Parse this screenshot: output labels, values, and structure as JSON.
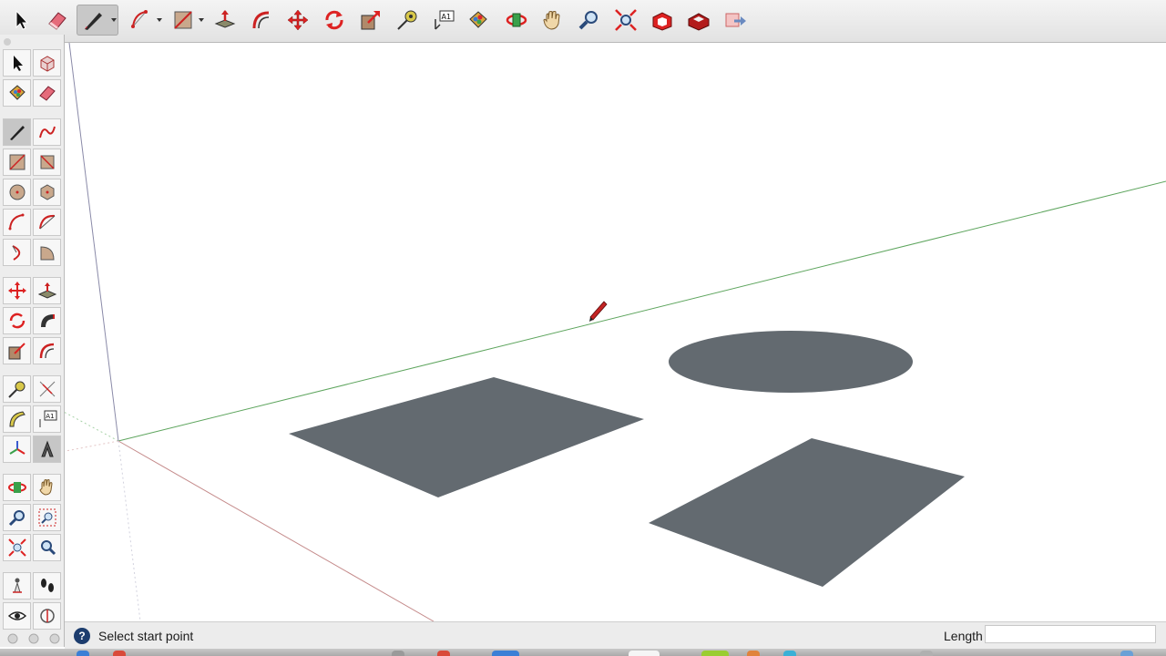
{
  "toolbar": {
    "tools": [
      {
        "name": "select-tool",
        "icon": "arrow-cursor-icon"
      },
      {
        "name": "eraser-tool",
        "icon": "eraser-icon"
      },
      {
        "name": "line-tool",
        "icon": "pencil-icon",
        "active": true
      },
      {
        "name": "arc-tool",
        "icon": "arc-icon"
      },
      {
        "name": "shape-tool",
        "icon": "rectangle-icon"
      },
      {
        "name": "push-pull-tool",
        "icon": "push-pull-icon"
      },
      {
        "name": "offset-tool",
        "icon": "offset-icon"
      },
      {
        "name": "move-tool",
        "icon": "move-icon"
      },
      {
        "name": "rotate-tool",
        "icon": "rotate-icon"
      },
      {
        "name": "scale-tool",
        "icon": "scale-icon"
      },
      {
        "name": "tape-measure-tool",
        "icon": "tape-measure-icon"
      },
      {
        "name": "text-tool",
        "icon": "text-label-icon",
        "label": "A1"
      },
      {
        "name": "paint-bucket-tool",
        "icon": "paint-bucket-icon"
      },
      {
        "name": "orbit-tool",
        "icon": "orbit-icon"
      },
      {
        "name": "pan-tool",
        "icon": "hand-icon"
      },
      {
        "name": "zoom-tool",
        "icon": "magnifier-icon"
      },
      {
        "name": "zoom-extents-tool",
        "icon": "zoom-extents-icon"
      },
      {
        "name": "3d-warehouse-button",
        "icon": "warehouse-icon"
      },
      {
        "name": "extension-warehouse-button",
        "icon": "extension-warehouse-icon"
      },
      {
        "name": "share-model-button",
        "icon": "share-model-icon"
      }
    ]
  },
  "palette": {
    "tools": [
      {
        "name": "select",
        "icon": "arrow-cursor-icon"
      },
      {
        "name": "make-component",
        "icon": "component-icon"
      },
      {
        "name": "paint-bucket",
        "icon": "paint-bucket-icon"
      },
      {
        "name": "eraser",
        "icon": "eraser-icon"
      },
      {
        "name": "line",
        "icon": "pencil-icon",
        "active": true
      },
      {
        "name": "freehand",
        "icon": "freehand-icon"
      },
      {
        "name": "rectangle",
        "icon": "rectangle-icon"
      },
      {
        "name": "rotated-rectangle",
        "icon": "rotated-rectangle-icon"
      },
      {
        "name": "circle",
        "icon": "circle-icon"
      },
      {
        "name": "polygon",
        "icon": "polygon-icon"
      },
      {
        "name": "arc",
        "icon": "arc-icon"
      },
      {
        "name": "two-point-arc",
        "icon": "two-point-arc-icon"
      },
      {
        "name": "three-point-arc",
        "icon": "three-point-arc-icon"
      },
      {
        "name": "pie",
        "icon": "pie-icon"
      },
      {
        "name": "move",
        "icon": "move-icon"
      },
      {
        "name": "push-pull",
        "icon": "push-pull-icon"
      },
      {
        "name": "rotate",
        "icon": "rotate-icon"
      },
      {
        "name": "follow-me",
        "icon": "follow-me-icon"
      },
      {
        "name": "scale",
        "icon": "scale-icon"
      },
      {
        "name": "offset",
        "icon": "offset-icon"
      },
      {
        "name": "tape-measure",
        "icon": "tape-measure-icon"
      },
      {
        "name": "dimension",
        "icon": "dimension-icon"
      },
      {
        "name": "protractor",
        "icon": "protractor-icon"
      },
      {
        "name": "text",
        "icon": "text-label-icon",
        "label": "A1"
      },
      {
        "name": "axes",
        "icon": "axes-icon"
      },
      {
        "name": "3d-text",
        "icon": "3d-text-icon"
      },
      {
        "name": "orbit",
        "icon": "orbit-icon"
      },
      {
        "name": "pan",
        "icon": "hand-icon"
      },
      {
        "name": "zoom",
        "icon": "magnifier-icon"
      },
      {
        "name": "zoom-window",
        "icon": "zoom-window-icon"
      },
      {
        "name": "zoom-extents",
        "icon": "zoom-extents-icon"
      },
      {
        "name": "previous-view",
        "icon": "previous-view-icon"
      },
      {
        "name": "position-camera",
        "icon": "position-camera-icon"
      },
      {
        "name": "walk",
        "icon": "footprints-icon"
      },
      {
        "name": "look-around",
        "icon": "eye-icon"
      },
      {
        "name": "section-plane",
        "icon": "section-plane-icon"
      }
    ]
  },
  "canvas": {
    "face_color": "#636a70",
    "red_axis_color": "#c48a8a",
    "green_axis_color": "#5ea55e",
    "blue_axis_color": "#8a8aa8",
    "cursor_icon": "pencil-cursor-icon",
    "shapes": [
      "rectangle",
      "circle",
      "rectangle"
    ]
  },
  "status": {
    "help_icon": "?",
    "message": "Select start point",
    "vcb_label": "Length",
    "vcb_value": ""
  }
}
